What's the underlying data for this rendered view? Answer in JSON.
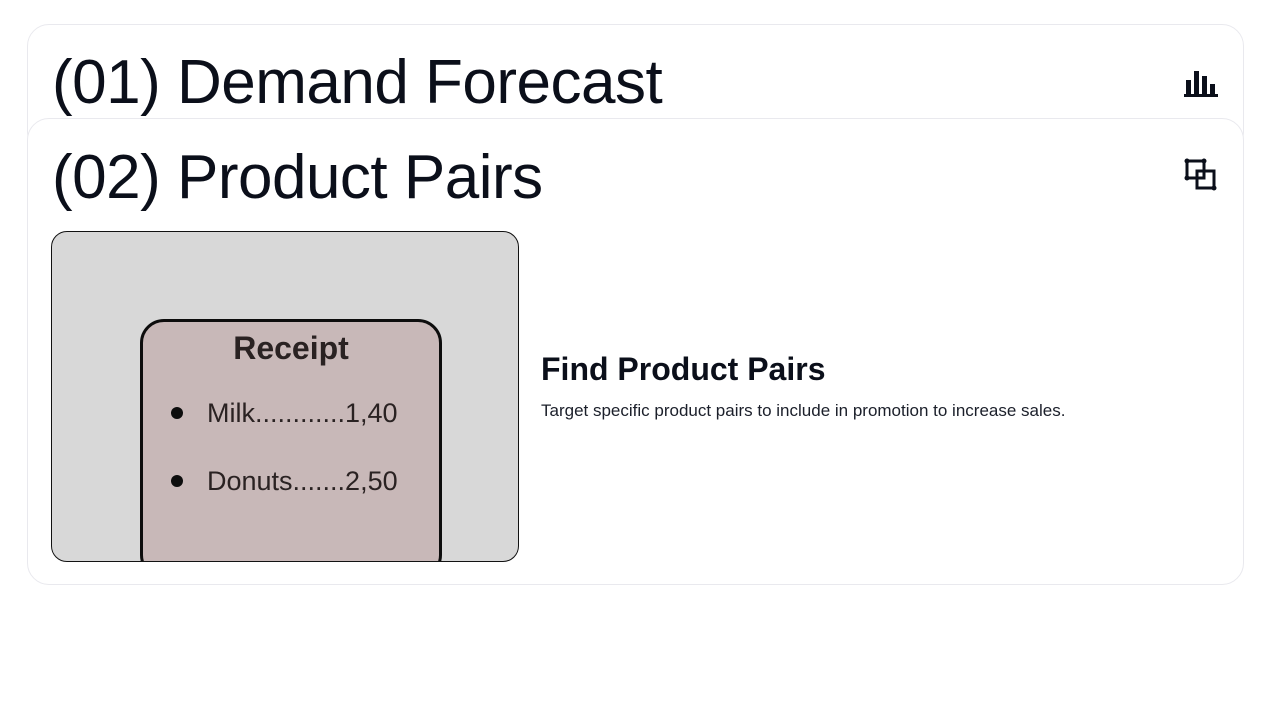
{
  "cards": [
    {
      "title": "(01) Demand Forecast",
      "icon": "bar-chart-icon"
    },
    {
      "title": "(02) Product Pairs",
      "icon": "product-pairs-icon",
      "feature": {
        "title": "Find Product Pairs",
        "description": "Target specific product pairs to include in promotion to increase sales."
      },
      "illustration": {
        "receipt_title": "Receipt",
        "items": [
          {
            "text": "Milk............1,40"
          },
          {
            "text": "Donuts.......2,50"
          }
        ]
      }
    }
  ],
  "colors": {
    "text": "#0b0f1a",
    "card_border": "#e9e9ee",
    "illustration_bg": "#d8d8d8",
    "receipt_bg": "#c8b8b8"
  }
}
